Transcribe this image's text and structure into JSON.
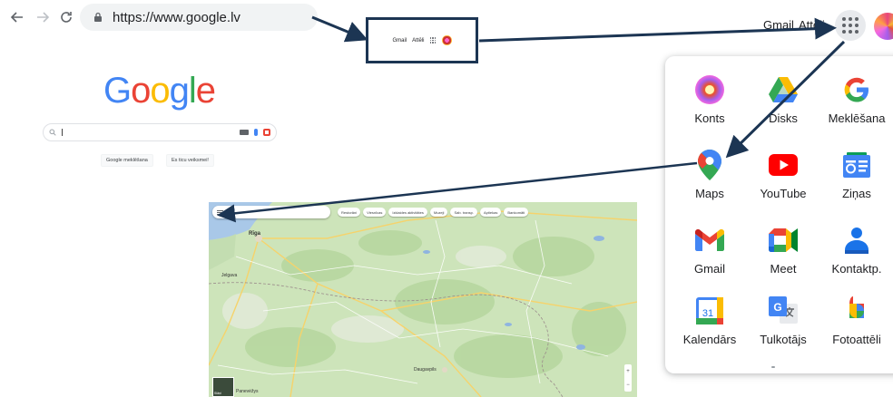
{
  "browser": {
    "url": "https://www.google.lv",
    "icons": [
      "back-arrow-icon",
      "forward-arrow-icon",
      "reload-icon",
      "lock-icon"
    ]
  },
  "header": {
    "gmail": "Gmail",
    "images": "Attēli",
    "icons": [
      "apps-grid-icon",
      "account-avatar"
    ]
  },
  "inset": {
    "gmail": "Gmail",
    "images": "Attēli"
  },
  "google_home": {
    "logo_letters": [
      "G",
      "o",
      "o",
      "g",
      "l",
      "e"
    ],
    "logo_colors": [
      "#4285f4",
      "#ea4335",
      "#fbbc05",
      "#4285f4",
      "#34a853",
      "#ea4335"
    ],
    "search_button": "Google meklēšana",
    "lucky_button": "Es ticu veiksmei!"
  },
  "map": {
    "chips": [
      "Restorāni",
      "Viesnīcas",
      "Izklaides aktivitātes",
      "Muzeji",
      "Sab. transp.",
      "Aptiekas",
      "Bankomāti"
    ],
    "city_labels": [
      "Rīga",
      "Jelgava",
      "Daugavpils",
      "Panevėžys"
    ],
    "layers_label": "Slāņi"
  },
  "apps": [
    {
      "label": "Konts",
      "icon": "account-icon"
    },
    {
      "label": "Disks",
      "icon": "google-drive-icon"
    },
    {
      "label": "Meklēšana",
      "icon": "google-search-icon"
    },
    {
      "label": "Maps",
      "icon": "google-maps-icon"
    },
    {
      "label": "YouTube",
      "icon": "youtube-icon"
    },
    {
      "label": "Ziņas",
      "icon": "google-news-icon"
    },
    {
      "label": "Gmail",
      "icon": "gmail-icon"
    },
    {
      "label": "Meet",
      "icon": "google-meet-icon"
    },
    {
      "label": "Kontaktp.",
      "icon": "contacts-icon"
    },
    {
      "label": "Kalendārs",
      "icon": "calendar-icon"
    },
    {
      "label": "Tulkotājs",
      "icon": "translate-icon"
    },
    {
      "label": "Fotoattēli",
      "icon": "photos-icon"
    }
  ],
  "calendar_day": "31"
}
